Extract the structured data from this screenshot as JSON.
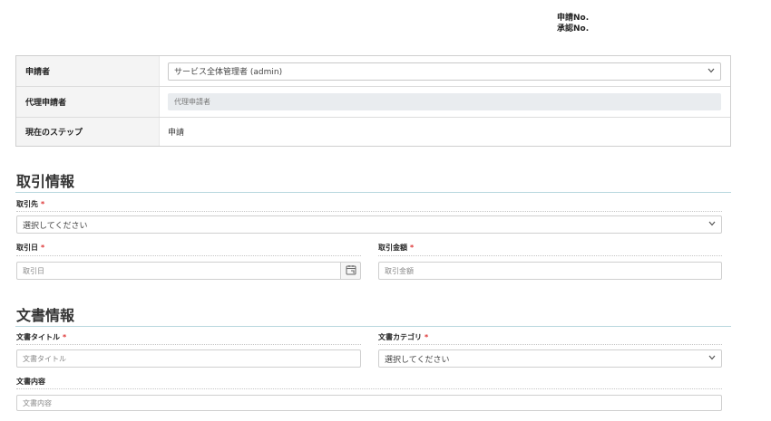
{
  "header": {
    "application_no_label": "申請No.",
    "approval_no_label": "承認No."
  },
  "applicant_info": {
    "applicant_label": "申請者",
    "applicant_value": "サービス全体管理者 (admin)",
    "proxy_label": "代理申請者",
    "proxy_placeholder": "代理申請者",
    "step_label": "現在のステップ",
    "step_value": "申請"
  },
  "transaction_section": {
    "title": "取引情報",
    "partner_label": "取引先",
    "partner_value": "選択してください",
    "date_label": "取引日",
    "date_placeholder": "取引日",
    "amount_label": "取引金額",
    "amount_placeholder": "取引金額",
    "required_mark": "*"
  },
  "document_section": {
    "title": "文書情報",
    "doc_title_label": "文書タイトル",
    "doc_title_placeholder": "文書タイトル",
    "doc_category_label": "文書カテゴリ",
    "doc_category_value": "選択してください",
    "doc_content_label": "文書内容",
    "doc_content_placeholder": "文書内容",
    "required_mark": "*"
  },
  "icons": {
    "chevron": "chevron-down-icon",
    "calendar": "calendar-icon"
  }
}
